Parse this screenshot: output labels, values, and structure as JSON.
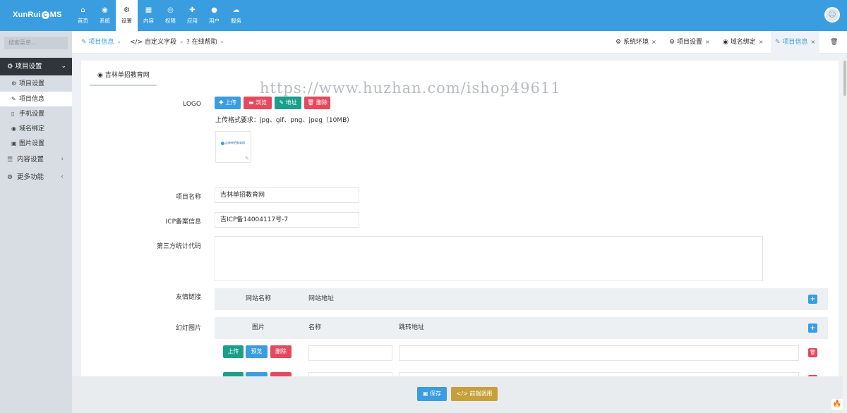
{
  "brand": {
    "logo_left": "XunRui",
    "logo_c": "C",
    "logo_right": "MS"
  },
  "nav": [
    {
      "label": "首页",
      "icon": "home-icon",
      "glyph": "⌂"
    },
    {
      "label": "系统",
      "icon": "globe-icon",
      "glyph": "◉"
    },
    {
      "label": "设置",
      "icon": "cogs-icon",
      "glyph": "⚙"
    },
    {
      "label": "内容",
      "icon": "grid-icon",
      "glyph": "▦"
    },
    {
      "label": "权限",
      "icon": "user-circle-icon",
      "glyph": "◎"
    },
    {
      "label": "应用",
      "icon": "puzzle-icon",
      "glyph": "✚"
    },
    {
      "label": "用户",
      "icon": "user-icon",
      "glyph": "●"
    },
    {
      "label": "服务",
      "icon": "cloud-icon",
      "glyph": "☁"
    }
  ],
  "sidebar": {
    "search_placeholder": "搜索菜单...",
    "head": "项目设置",
    "items": [
      {
        "label": "项目设置",
        "glyph": "⚙"
      },
      {
        "label": "项目信息",
        "glyph": "✎"
      },
      {
        "label": "手机设置",
        "glyph": "▯"
      },
      {
        "label": "域名绑定",
        "glyph": "◉"
      },
      {
        "label": "图片设置",
        "glyph": "▣"
      }
    ],
    "groups": [
      {
        "label": "内容设置",
        "glyph": "☰"
      },
      {
        "label": "更多功能",
        "glyph": "⚙"
      }
    ]
  },
  "breadcrumbs": [
    {
      "label": "项目信息",
      "glyph": "✎"
    },
    {
      "label": "自定义字段",
      "glyph": "</>"
    },
    {
      "label": "在线帮助",
      "glyph": "?"
    }
  ],
  "tabs": [
    {
      "label": "系统环境",
      "glyph": "⚙"
    },
    {
      "label": "项目设置",
      "glyph": "⚙"
    },
    {
      "label": "域名绑定",
      "glyph": "◉"
    },
    {
      "label": "项目信息",
      "glyph": "✎"
    }
  ],
  "panel": {
    "tab_title": "吉林单招教育网",
    "watermark": "https://www.huzhan.com/ishop49611",
    "logo_label": "LOGO",
    "btn_upload": "上传",
    "btn_browse": "浏览",
    "btn_address": "地址",
    "btn_delete": "删除",
    "upload_hint": "上传格式要求：jpg、gif、png、jpeg（10MB）",
    "thumb_text": "吉林单招教育网",
    "name_label": "项目名称",
    "name_value": "吉林单招教育网",
    "icp_label": "ICP备案信息",
    "icp_value": "吉ICP备14004117号-7",
    "stats_label": "第三方统计代码",
    "links_label": "友情链接",
    "links_col1": "网站名称",
    "links_col2": "网站地址",
    "slides_label": "幻灯图片",
    "slides_col1": "图片",
    "slides_col2": "名称",
    "slides_col3": "跳转地址",
    "row_upload": "上传",
    "row_preview": "预览",
    "row_delete": "删除"
  },
  "footer": {
    "save": "保存",
    "frontend": "前端调用"
  }
}
